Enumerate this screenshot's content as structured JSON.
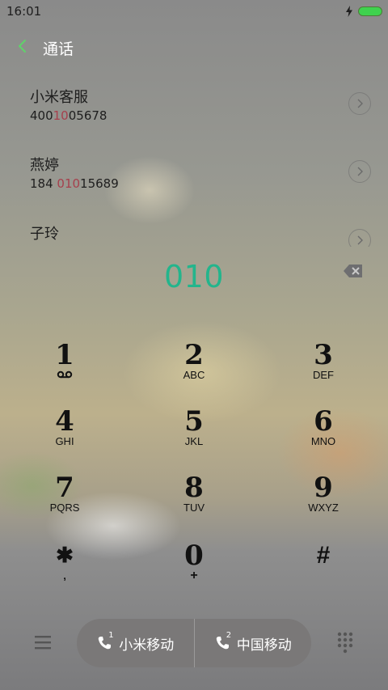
{
  "status_bar": {
    "time": "16:01",
    "charging_icon": "bolt-icon",
    "battery_icon": "battery-icon",
    "battery_color": "#3fd24e"
  },
  "header": {
    "back_icon": "chevron-left-icon",
    "title": "通话",
    "accent": "#5fd36a"
  },
  "contacts": [
    {
      "name": "小米客服",
      "number_before": "400",
      "number_match": "10",
      "number_after": "05678"
    },
    {
      "name": "燕婷",
      "number_before": "184 ",
      "number_match": "010",
      "number_after": "15689"
    },
    {
      "name": "子玲",
      "number_before": "",
      "number_match": "",
      "number_after": ""
    }
  ],
  "dial": {
    "input": "010",
    "color": "#23b58c",
    "backspace_icon": "backspace-icon"
  },
  "keypad": [
    {
      "digit": "1",
      "letters": "",
      "icon": "voicemail-icon"
    },
    {
      "digit": "2",
      "letters": "ABC"
    },
    {
      "digit": "3",
      "letters": "DEF"
    },
    {
      "digit": "4",
      "letters": "GHI"
    },
    {
      "digit": "5",
      "letters": "JKL"
    },
    {
      "digit": "6",
      "letters": "MNO"
    },
    {
      "digit": "7",
      "letters": "PQRS"
    },
    {
      "digit": "8",
      "letters": "TUV"
    },
    {
      "digit": "9",
      "letters": "WXYZ"
    },
    {
      "digit": "✱",
      "letters": ","
    },
    {
      "digit": "0",
      "letters": "+"
    },
    {
      "digit": "#",
      "letters": ""
    }
  ],
  "bottom": {
    "menu_icon": "menu-icon",
    "dialpad_icon": "dialpad-grid-icon",
    "call_sim1": {
      "sim": "1",
      "label": "小米移动"
    },
    "call_sim2": {
      "sim": "2",
      "label": "中国移动"
    }
  }
}
